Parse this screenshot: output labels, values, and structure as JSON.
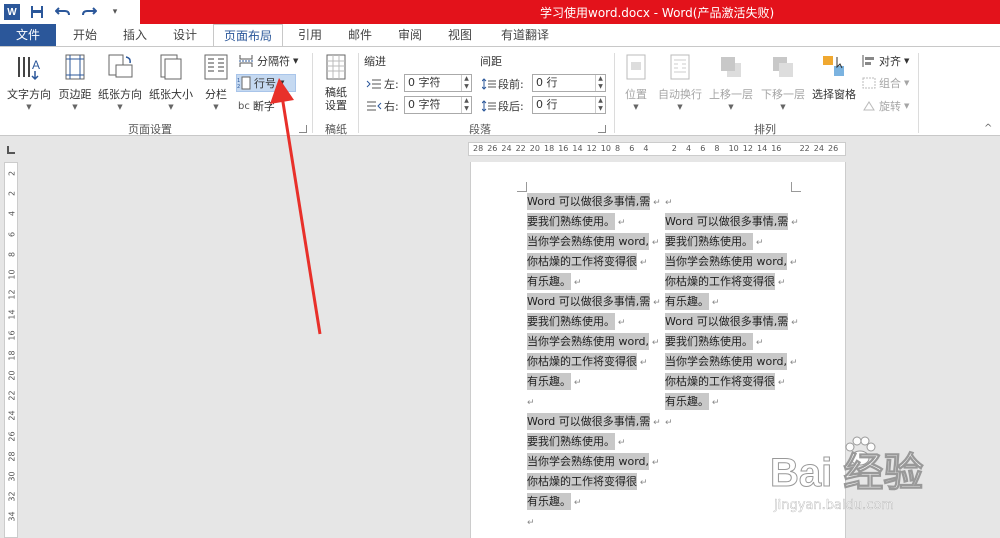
{
  "window": {
    "title": "学习使用word.docx - Word(产品激活失败)",
    "app_logo": "W"
  },
  "qat": {
    "icons": [
      "word-logo",
      "save-icon",
      "undo-icon",
      "redo-icon",
      "customize-icon"
    ]
  },
  "tabs": [
    {
      "label": "文件"
    },
    {
      "label": "开始"
    },
    {
      "label": "插入"
    },
    {
      "label": "设计"
    },
    {
      "label": "页面布局",
      "active": true
    },
    {
      "label": "引用"
    },
    {
      "label": "邮件"
    },
    {
      "label": "审阅"
    },
    {
      "label": "视图"
    },
    {
      "label": "有道翻译"
    }
  ],
  "ribbon": {
    "page_setup": {
      "label": "页面设置",
      "text_direction": "文字方向",
      "margins": "页边距",
      "orientation": "纸张方向",
      "size": "纸张大小",
      "columns": "分栏",
      "breaks": "分隔符",
      "line_numbers": "行号",
      "hyphenation": "断字"
    },
    "draft": {
      "label": "稿纸",
      "settings": "稿纸设置"
    },
    "paragraph": {
      "label": "段落",
      "indent": "缩进",
      "spacing": "间距",
      "left_label": "左:",
      "right_label": "右:",
      "before_label": "段前:",
      "after_label": "段后:",
      "left_value": "0 字符",
      "right_value": "0 字符",
      "before_value": "0 行",
      "after_value": "0 行"
    },
    "arrange": {
      "label": "排列",
      "position": "位置",
      "wrap": "自动换行",
      "bring_forward": "上移一层",
      "send_backward": "下移一层",
      "selection_pane": "选择窗格",
      "align": "对齐",
      "group": "组合",
      "rotate": "旋转"
    }
  },
  "ruler": {
    "h_ticks": [
      "28",
      "26",
      "24",
      "22",
      "20",
      "18",
      "16",
      "14",
      "12",
      "10",
      "8",
      "6",
      "4",
      "",
      "2",
      "4",
      "6",
      "8",
      "10",
      "12",
      "14",
      "16",
      "",
      "22",
      "24",
      "26"
    ],
    "v_ticks": [
      "2",
      "2",
      "4",
      "6",
      "8",
      "10",
      "12",
      "14",
      "16",
      "18",
      "20",
      "22",
      "24",
      "26",
      "28",
      "30",
      "32",
      "34"
    ]
  },
  "document": {
    "col1": [
      "Word 可以做很多事情,需",
      "要我们熟练使用。",
      "当你学会熟练使用 word,",
      "你枯燥的工作将变得很",
      "有乐趣。",
      "Word 可以做很多事情,需",
      "要我们熟练使用。",
      "当你学会熟练使用 word,",
      "你枯燥的工作将变得很",
      "有乐趣。",
      "",
      "Word 可以做很多事情,需",
      "要我们熟练使用。",
      "当你学会熟练使用 word,",
      "你枯燥的工作将变得很",
      "有乐趣。",
      ""
    ],
    "col2": [
      "",
      "Word 可以做很多事情,需",
      "要我们熟练使用。",
      "当你学会熟练使用 word,",
      "你枯燥的工作将变得很",
      "有乐趣。",
      "Word 可以做很多事情,需",
      "要我们熟练使用。",
      "当你学会熟练使用 word,",
      "你枯燥的工作将变得很",
      "有乐趣。",
      ""
    ],
    "para_mark": "↵"
  },
  "watermark": {
    "main": "Bai 经验",
    "sub": "jingyan.baidu.com"
  },
  "colors": {
    "title_red": "#e3121b",
    "file_tab": "#2b579a",
    "annotation_arrow": "#e8302a",
    "selection_highlight": "#c8c8c8"
  }
}
